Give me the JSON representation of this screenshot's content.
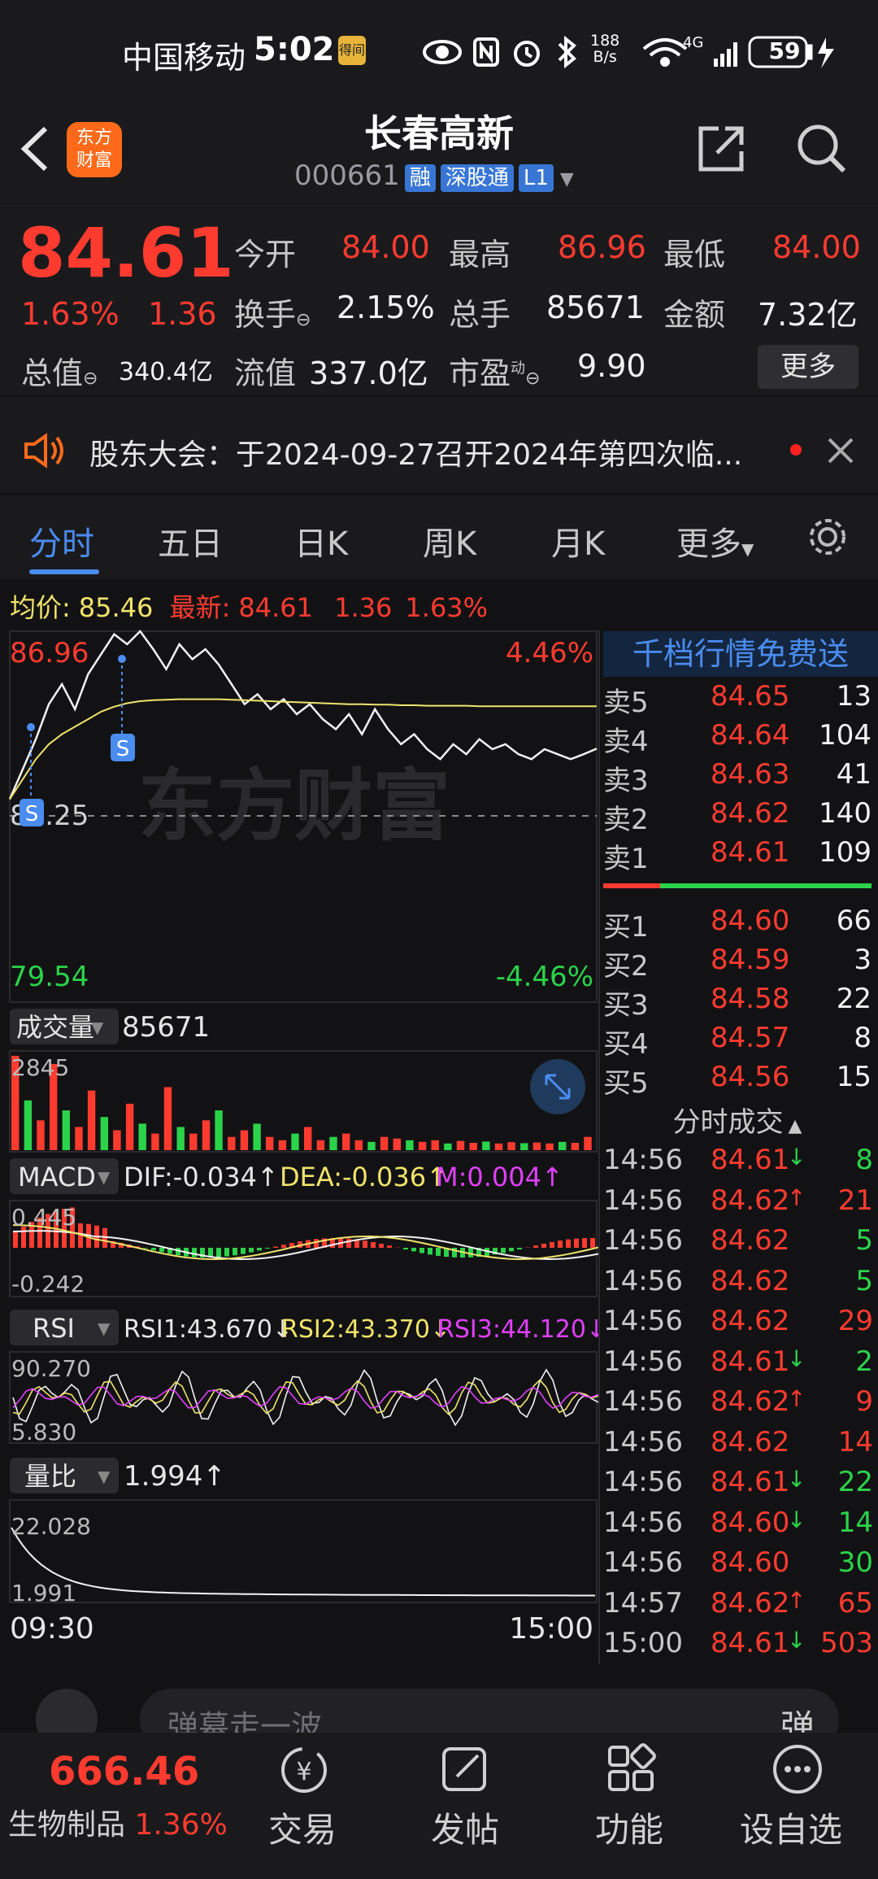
{
  "status": {
    "carrier": "中国移动",
    "time": "5:02",
    "badge": "得间",
    "net_speed": "188",
    "net_unit": "B/s",
    "network": "4G",
    "battery": "59"
  },
  "header": {
    "title": "长春高新",
    "code": "000661",
    "tags": [
      "融",
      "深股通",
      "L1"
    ],
    "logo_line1": "东方",
    "logo_line2": "财富"
  },
  "quote": {
    "price": "84.61",
    "pct": "1.63%",
    "chg": "1.36",
    "open_label": "今开",
    "open": "84.00",
    "high_label": "最高",
    "high": "86.96",
    "low_label": "最低",
    "low": "84.00",
    "turnover_label": "换手",
    "turnover": "2.15%",
    "volume_label": "总手",
    "volume": "85671",
    "amount_label": "金额",
    "amount": "7.32亿",
    "mcap_label": "总值",
    "mcap": "340.4亿",
    "float_label": "流值",
    "float": "337.0亿",
    "pe_label": "市盈",
    "pe_sup": "动",
    "pe": "9.90",
    "more": "更多"
  },
  "notice": {
    "text": "股东大会：于2024-09-27召开2024年第四次临..."
  },
  "tabs": [
    "分时",
    "五日",
    "日K",
    "周K",
    "月K",
    "更多"
  ],
  "chart_info": {
    "avg_label": "均价:",
    "avg": "85.46",
    "last_label": "最新:",
    "last": "84.61",
    "chg": "1.36",
    "pct": "1.63%"
  },
  "chart_data": {
    "type": "line",
    "title": "",
    "ylim": [
      79.54,
      86.96
    ],
    "y_ticks": [
      "86.96",
      "83.25",
      "79.54"
    ],
    "pct_ticks": [
      "4.46%",
      "-4.46%"
    ],
    "x_ticks": [
      "09:30",
      "15:00"
    ],
    "watermark": "东方财富",
    "marker_label": "S",
    "series": [
      {
        "values": [
          83.6,
          84.2,
          84.8,
          85.5,
          85.9,
          85.4,
          86.1,
          86.5,
          86.9,
          86.7,
          86.96,
          86.6,
          86.2,
          86.7,
          86.4,
          86.6,
          86.3,
          85.9,
          85.5,
          85.7,
          85.4,
          85.6,
          85.3,
          85.5,
          85.2,
          85.0,
          85.3,
          84.9,
          85.4,
          85.0,
          84.7,
          84.9,
          84.6,
          84.4,
          84.7,
          84.5,
          84.8,
          84.6,
          84.7,
          84.5,
          84.4,
          84.6,
          84.5,
          84.4,
          84.5,
          84.61
        ]
      },
      {
        "values": [
          83.6,
          84.0,
          84.4,
          84.7,
          84.9,
          85.05,
          85.2,
          85.35,
          85.45,
          85.52,
          85.56,
          85.58,
          85.59,
          85.6,
          85.6,
          85.6,
          85.6,
          85.59,
          85.58,
          85.57,
          85.56,
          85.55,
          85.54,
          85.53,
          85.52,
          85.51,
          85.5,
          85.5,
          85.49,
          85.49,
          85.48,
          85.48,
          85.47,
          85.47,
          85.47,
          85.47,
          85.46,
          85.46,
          85.46,
          85.46,
          85.46,
          85.46,
          85.46,
          85.46,
          85.46,
          85.46
        ]
      }
    ]
  },
  "volume_panel": {
    "label": "成交量",
    "value": "85671",
    "max": "2845",
    "bars": [
      2845,
      1500,
      900,
      2600,
      1200,
      700,
      1800,
      1000,
      600,
      1400,
      800,
      500,
      1900,
      700,
      500,
      900,
      1200,
      400,
      600,
      800,
      400,
      300,
      500,
      700,
      300,
      400,
      500,
      300,
      250,
      400,
      350,
      300,
      250,
      300,
      200,
      280,
      220,
      260,
      200,
      240,
      210,
      230,
      200,
      250,
      220,
      400
    ]
  },
  "macd_panel": {
    "label": "MACD",
    "dif": "DIF:-0.034↑",
    "dea": "DEA:-0.036↑",
    "m": "M:0.004↑",
    "max": "0.445",
    "min": "-0.242"
  },
  "rsi_panel": {
    "label": "RSI",
    "rsi1": "RSI1:43.670↓",
    "rsi2": "RSI2:43.370↓",
    "rsi3": "RSI3:44.120↓",
    "max": "90.270",
    "min": "5.830"
  },
  "ratio_panel": {
    "label": "量比",
    "value": "1.994↑",
    "max": "22.028",
    "min": "1.991",
    "time_start": "09:30",
    "time_end": "15:00"
  },
  "orderbook": {
    "promo": "千档行情免费送",
    "asks": [
      [
        "卖5",
        "84.65",
        "13"
      ],
      [
        "卖4",
        "84.64",
        "104"
      ],
      [
        "卖3",
        "84.63",
        "41"
      ],
      [
        "卖2",
        "84.62",
        "140"
      ],
      [
        "卖1",
        "84.61",
        "109"
      ]
    ],
    "bids": [
      [
        "买1",
        "84.60",
        "66"
      ],
      [
        "买2",
        "84.59",
        "3"
      ],
      [
        "买3",
        "84.58",
        "22"
      ],
      [
        "买4",
        "84.57",
        "8"
      ],
      [
        "买5",
        "84.56",
        "15"
      ]
    ]
  },
  "ticks": {
    "title": "分时成交",
    "rows": [
      [
        "14:56",
        "84.61",
        "↓",
        "8",
        "g"
      ],
      [
        "14:56",
        "84.62",
        "↑",
        "21",
        "r"
      ],
      [
        "14:56",
        "84.62",
        "",
        "5",
        "g"
      ],
      [
        "14:56",
        "84.62",
        "",
        "5",
        "g"
      ],
      [
        "14:56",
        "84.62",
        "",
        "29",
        "r"
      ],
      [
        "14:56",
        "84.61",
        "↓",
        "2",
        "g"
      ],
      [
        "14:56",
        "84.62",
        "↑",
        "9",
        "r"
      ],
      [
        "14:56",
        "84.62",
        "",
        "14",
        "r"
      ],
      [
        "14:56",
        "84.61",
        "↓",
        "22",
        "g"
      ],
      [
        "14:56",
        "84.60",
        "↓",
        "14",
        "g"
      ],
      [
        "14:56",
        "84.60",
        "",
        "30",
        "g"
      ],
      [
        "14:57",
        "84.62",
        "↑",
        "65",
        "r"
      ],
      [
        "15:00",
        "84.61",
        "↓",
        "503",
        "r"
      ]
    ]
  },
  "comment": {
    "placeholder": "弹幕走一波...",
    "btn": "弹"
  },
  "bottom": {
    "index_value": "666.46",
    "index_name": "生物制品",
    "index_pct": "1.36%",
    "items": [
      "交易",
      "发帖",
      "功能",
      "设自选"
    ]
  },
  "colors": {
    "up": "#ff3b30",
    "down": "#2bd34a",
    "avg": "#f0e36a",
    "accent": "#4a8cf0",
    "brand": "#ff6a1a"
  }
}
